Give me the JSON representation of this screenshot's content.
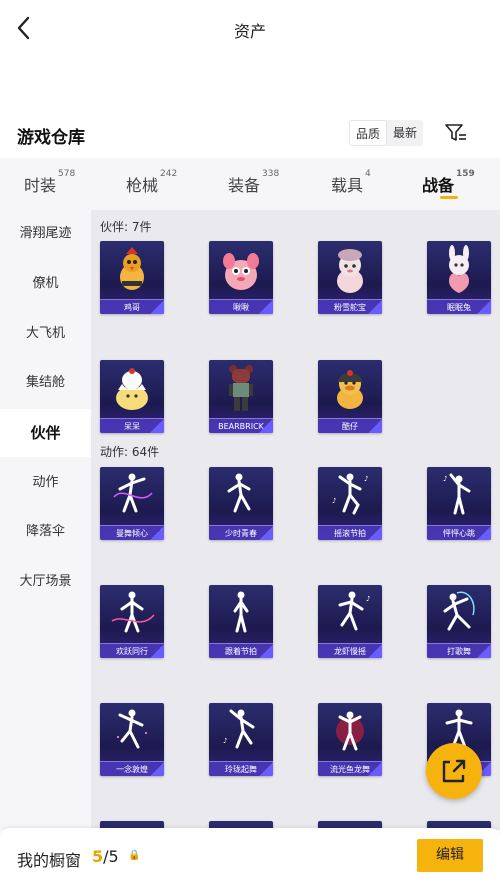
{
  "header": {
    "title": "资产"
  },
  "warehouse": {
    "title": "游戏仓库",
    "sort_options": [
      "品质",
      "最新"
    ]
  },
  "tabs": [
    {
      "label": "时装",
      "count": "578"
    },
    {
      "label": "枪械",
      "count": "242"
    },
    {
      "label": "装备",
      "count": "338"
    },
    {
      "label": "载具",
      "count": "4"
    },
    {
      "label": "战备",
      "count": "159"
    }
  ],
  "sidebar": {
    "items": [
      "滑翔尾迹",
      "僚机",
      "大飞机",
      "集结舱",
      "伙伴",
      "动作",
      "降落伞",
      "大厅场景"
    ],
    "active_index": 4
  },
  "groups": {
    "partners_label": "伙伴: 7件",
    "actions_label": "动作: 64件"
  },
  "partners": [
    "鸡哥",
    "啾啾",
    "粉雪舵宝",
    "眠眠兔",
    "呆呆",
    "BEARBRICK",
    "酷仔"
  ],
  "actions": [
    "曼舞倾心",
    "少时青春",
    "摇滚节拍",
    "怦怦心跳",
    "欢跃同行",
    "跟着节拍",
    "龙虾慢摇",
    "打歌舞",
    "一念敦煌",
    "玲珑起舞",
    "流光鱼龙舞",
    ""
  ],
  "bottom": {
    "label": "我的橱窗",
    "current": "5",
    "total": "/5",
    "lock_glyph": "🔒",
    "edit_label": "编辑"
  },
  "colors": {
    "accent": "#f7b30d",
    "card_bg": "#1d1a4f"
  }
}
